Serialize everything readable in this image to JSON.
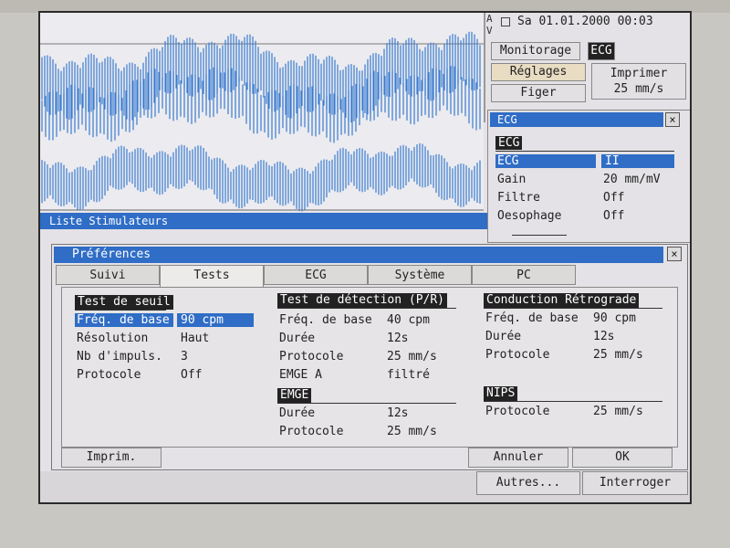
{
  "header": {
    "channel_marks": "A V",
    "datetime": "Sa 01.01.2000 00:03"
  },
  "topbuttons": {
    "monitorage": "Monitorage",
    "ecg_tag": "ECG",
    "reglages": "Réglages",
    "imprimer": "Imprimer",
    "speed": "25 mm/s",
    "figer": "Figer"
  },
  "list_bar": {
    "label": "Liste Stimulateurs"
  },
  "ecg_panel": {
    "title": "ECG",
    "section": "ECG",
    "rows": [
      {
        "label": "ECG",
        "value": "II"
      },
      {
        "label": "Gain",
        "value": "20 mm/mV"
      },
      {
        "label": "Filtre",
        "value": "Off"
      },
      {
        "label": "Oesophage",
        "value": "Off"
      }
    ]
  },
  "prefs": {
    "title": "Préférences",
    "tabs": [
      "Suivi",
      "Tests",
      "ECG",
      "Système",
      "PC"
    ],
    "selected_tab": "Tests",
    "seuil": {
      "header": "Test de seuil",
      "rows": [
        {
          "label": "Fréq. de base",
          "value": "90  cpm"
        },
        {
          "label": "Résolution",
          "value": "Haut"
        },
        {
          "label": "Nb d'impuls.",
          "value": "3"
        },
        {
          "label": "Protocole",
          "value": "Off"
        }
      ]
    },
    "detection": {
      "header": "Test de détection (P/R)",
      "rows": [
        {
          "label": "Fréq. de base",
          "value": "40  cpm"
        },
        {
          "label": "Durée",
          "value": "12s"
        },
        {
          "label": "Protocole",
          "value": "25 mm/s"
        },
        {
          "label": "EMGE A",
          "value": "filtré"
        }
      ]
    },
    "emge": {
      "header": "EMGE",
      "rows": [
        {
          "label": "Durée",
          "value": "12s"
        },
        {
          "label": "Protocole",
          "value": "25 mm/s"
        }
      ]
    },
    "conduction": {
      "header": "Conduction Rétrograde",
      "rows": [
        {
          "label": "Fréq. de base",
          "value": "90  cpm"
        },
        {
          "label": "Durée",
          "value": "12s"
        },
        {
          "label": "Protocole",
          "value": "25 mm/s"
        }
      ]
    },
    "nips": {
      "header": "NIPS",
      "rows": [
        {
          "label": "Protocole",
          "value": "25 mm/s"
        }
      ]
    },
    "buttons": {
      "imprim": "Imprim.",
      "annuler": "Annuler",
      "ok": "OK"
    }
  },
  "bottom": {
    "autres": "Autres...",
    "interroger": "Interroger"
  },
  "close_glyph": "×",
  "colors": {
    "accent": "#2f6dc6",
    "trace": "#3a7bd0",
    "screen_bg": "#e4e2e6"
  }
}
